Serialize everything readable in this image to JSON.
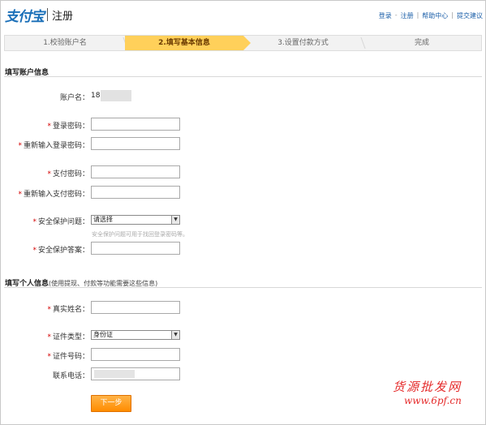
{
  "header": {
    "logo_text": "支付宝",
    "title": "注册",
    "links": [
      "登录",
      "注册",
      "帮助中心",
      "提交建议"
    ]
  },
  "steps": [
    "1.校验账户名",
    "2.填写基本信息",
    "3.设置付款方式",
    "完成"
  ],
  "account_section": {
    "title": "填写账户信息",
    "account_name_label": "账户名：",
    "account_name_value": "18",
    "login_password_label": "登录密码：",
    "confirm_login_password_label": "重新输入登录密码：",
    "pay_password_label": "支付密码：",
    "confirm_pay_password_label": "重新输入支付密码：",
    "security_question_label": "安全保护问题：",
    "security_question_selected": "请选择",
    "security_hint": "安全保护问题可用于找回登录密码等。",
    "security_answer_label": "安全保护答案："
  },
  "personal_section": {
    "title": "填写个人信息",
    "subtitle": "(使用提现、付款等功能需要这些信息)",
    "real_name_label": "真实姓名：",
    "id_type_label": "证件类型：",
    "id_type_selected": "身份证",
    "id_number_label": "证件号码：",
    "phone_label": "联系电话："
  },
  "next_button": "下一步",
  "watermark": {
    "line1": "货源批发网",
    "line2": "www.6pf.cn"
  },
  "colors": {
    "active_step": "#ffd05a",
    "required": "#d40000",
    "link": "#1a5ea8",
    "button": "#ff9a20",
    "watermark": "#e52b2b"
  }
}
